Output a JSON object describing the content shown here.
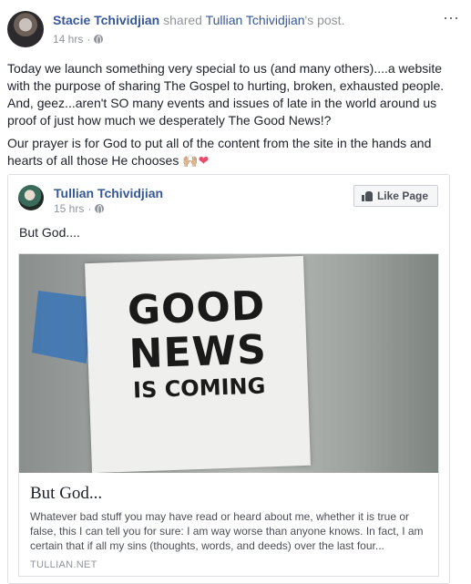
{
  "post": {
    "author": "Stacie Tchividjian",
    "shared_word": "shared",
    "shared_author": "Tullian Tchividjian",
    "shared_suffix": "'s post.",
    "timestamp": "14 hrs",
    "separator": "·",
    "more_icon": "⋯",
    "paragraph_1": "Today we launch something very special to us (and many others)....a website with the purpose of sharing The Gospel to hurting, broken, exhausted people. And, geez...aren't SO many events and issues of late in the world around us proof of just how much we desperately The Good News!?",
    "paragraph_2": "Our prayer is for God to put all of the content from the site in the hands and hearts of all those He chooses",
    "emoji_hands": "🙌🏼",
    "emoji_heart": "❤"
  },
  "shared_post": {
    "author": "Tullian Tchividjian",
    "timestamp": "15 hrs",
    "separator": "·",
    "like_button": "Like Page",
    "text": "But God....",
    "image_text": {
      "line1": "GOOD",
      "line2": "NEWS",
      "line3": "IS COMING"
    },
    "link_title": "But God...",
    "link_description": "Whatever bad stuff you may have read or heard about me, whether it is true or false, this I can tell you for sure: I am way worse than anyone knows. In fact, I am certain that if all my sins (thoughts, words, and deeds) over the last four...",
    "link_domain": "TULLIAN.NET"
  }
}
